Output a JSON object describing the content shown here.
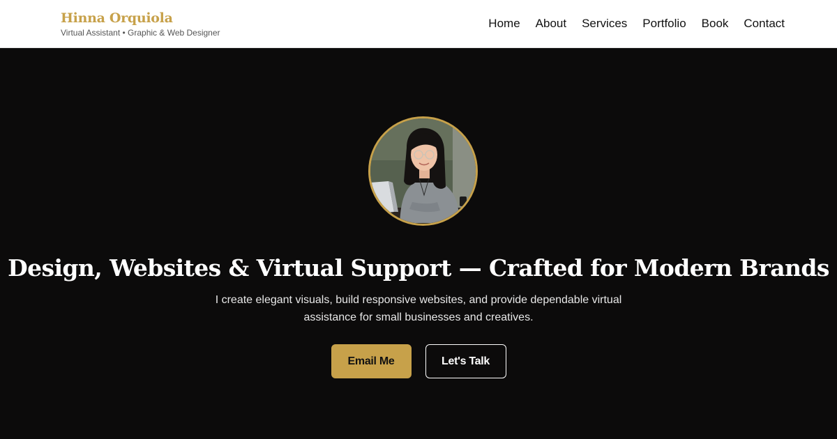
{
  "brand": {
    "name": "Hinna Orquiola",
    "tagline": "Virtual Assistant • Graphic & Web Designer"
  },
  "nav": {
    "items": [
      "Home",
      "About",
      "Services",
      "Portfolio",
      "Book",
      "Contact"
    ]
  },
  "hero": {
    "headline": "Design, Websites & Virtual Support — Crafted for Modern Brands",
    "subtext": "I create elegant visuals, build responsive websites, and provide dependable virtual assistance for small businesses and creatives.",
    "primary_button": "Email Me",
    "secondary_button": "Let's Talk"
  },
  "colors": {
    "accent": "#c7a14a",
    "hero_background": "#0c0b0b",
    "header_background": "#ffffff"
  }
}
